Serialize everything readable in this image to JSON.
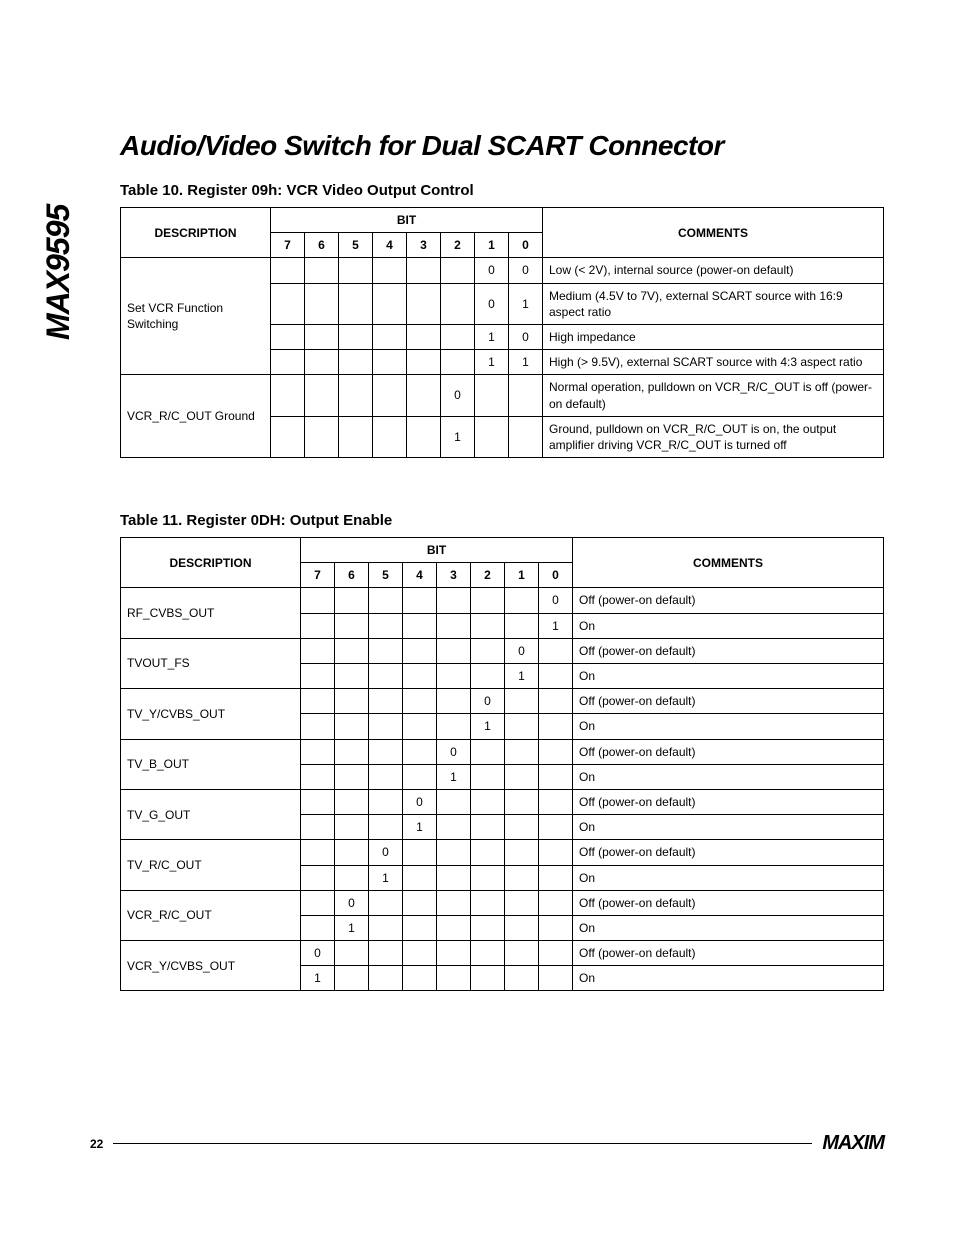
{
  "side_label": "MAX9595",
  "title": "Audio/Video Switch for Dual SCART Connector",
  "table10": {
    "caption": "Table 10. Register 09h: VCR Video Output Control",
    "headers": {
      "desc": "DESCRIPTION",
      "bit": "BIT",
      "bits": [
        "7",
        "6",
        "5",
        "4",
        "3",
        "2",
        "1",
        "0"
      ],
      "comments": "COMMENTS"
    },
    "groups": [
      {
        "desc": "Set VCR Function Switching",
        "rows": [
          {
            "b7": "",
            "b6": "",
            "b5": "",
            "b4": "",
            "b3": "",
            "b2": "",
            "b1": "0",
            "b0": "0",
            "comment": "Low (< 2V), internal source (power-on default)"
          },
          {
            "b7": "",
            "b6": "",
            "b5": "",
            "b4": "",
            "b3": "",
            "b2": "",
            "b1": "0",
            "b0": "1",
            "comment": "Medium (4.5V to 7V), external SCART source with 16:9 aspect ratio"
          },
          {
            "b7": "",
            "b6": "",
            "b5": "",
            "b4": "",
            "b3": "",
            "b2": "",
            "b1": "1",
            "b0": "0",
            "comment": "High impedance"
          },
          {
            "b7": "",
            "b6": "",
            "b5": "",
            "b4": "",
            "b3": "",
            "b2": "",
            "b1": "1",
            "b0": "1",
            "comment": "High (> 9.5V), external SCART source with 4:3 aspect ratio"
          }
        ]
      },
      {
        "desc": "VCR_R/C_OUT Ground",
        "rows": [
          {
            "b7": "",
            "b6": "",
            "b5": "",
            "b4": "",
            "b3": "",
            "b2": "0",
            "b1": "",
            "b0": "",
            "comment": "Normal operation, pulldown on VCR_R/C_OUT is off (power-on default)"
          },
          {
            "b7": "",
            "b6": "",
            "b5": "",
            "b4": "",
            "b3": "",
            "b2": "1",
            "b1": "",
            "b0": "",
            "comment": "Ground, pulldown on VCR_R/C_OUT is on, the output amplifier driving VCR_R/C_OUT is turned off"
          }
        ]
      }
    ]
  },
  "table11": {
    "caption": "Table 11. Register 0DH: Output Enable",
    "headers": {
      "desc": "DESCRIPTION",
      "bit": "BIT",
      "bits": [
        "7",
        "6",
        "5",
        "4",
        "3",
        "2",
        "1",
        "0"
      ],
      "comments": "COMMENTS"
    },
    "groups": [
      {
        "desc": "RF_CVBS_OUT",
        "rows": [
          {
            "b7": "",
            "b6": "",
            "b5": "",
            "b4": "",
            "b3": "",
            "b2": "",
            "b1": "",
            "b0": "0",
            "comment": "Off (power-on default)"
          },
          {
            "b7": "",
            "b6": "",
            "b5": "",
            "b4": "",
            "b3": "",
            "b2": "",
            "b1": "",
            "b0": "1",
            "comment": "On"
          }
        ]
      },
      {
        "desc": "TVOUT_FS",
        "rows": [
          {
            "b7": "",
            "b6": "",
            "b5": "",
            "b4": "",
            "b3": "",
            "b2": "",
            "b1": "0",
            "b0": "",
            "comment": "Off (power-on default)"
          },
          {
            "b7": "",
            "b6": "",
            "b5": "",
            "b4": "",
            "b3": "",
            "b2": "",
            "b1": "1",
            "b0": "",
            "comment": "On"
          }
        ]
      },
      {
        "desc": "TV_Y/CVBS_OUT",
        "rows": [
          {
            "b7": "",
            "b6": "",
            "b5": "",
            "b4": "",
            "b3": "",
            "b2": "0",
            "b1": "",
            "b0": "",
            "comment": "Off (power-on default)"
          },
          {
            "b7": "",
            "b6": "",
            "b5": "",
            "b4": "",
            "b3": "",
            "b2": "1",
            "b1": "",
            "b0": "",
            "comment": "On"
          }
        ]
      },
      {
        "desc": "TV_B_OUT",
        "rows": [
          {
            "b7": "",
            "b6": "",
            "b5": "",
            "b4": "",
            "b3": "0",
            "b2": "",
            "b1": "",
            "b0": "",
            "comment": "Off (power-on default)"
          },
          {
            "b7": "",
            "b6": "",
            "b5": "",
            "b4": "",
            "b3": "1",
            "b2": "",
            "b1": "",
            "b0": "",
            "comment": "On"
          }
        ]
      },
      {
        "desc": "TV_G_OUT",
        "rows": [
          {
            "b7": "",
            "b6": "",
            "b5": "",
            "b4": "0",
            "b3": "",
            "b2": "",
            "b1": "",
            "b0": "",
            "comment": "Off (power-on default)"
          },
          {
            "b7": "",
            "b6": "",
            "b5": "",
            "b4": "1",
            "b3": "",
            "b2": "",
            "b1": "",
            "b0": "",
            "comment": "On"
          }
        ]
      },
      {
        "desc": "TV_R/C_OUT",
        "rows": [
          {
            "b7": "",
            "b6": "",
            "b5": "0",
            "b4": "",
            "b3": "",
            "b2": "",
            "b1": "",
            "b0": "",
            "comment": "Off (power-on default)"
          },
          {
            "b7": "",
            "b6": "",
            "b5": "1",
            "b4": "",
            "b3": "",
            "b2": "",
            "b1": "",
            "b0": "",
            "comment": "On"
          }
        ]
      },
      {
        "desc": "VCR_R/C_OUT",
        "rows": [
          {
            "b7": "",
            "b6": "0",
            "b5": "",
            "b4": "",
            "b3": "",
            "b2": "",
            "b1": "",
            "b0": "",
            "comment": "Off (power-on default)"
          },
          {
            "b7": "",
            "b6": "1",
            "b5": "",
            "b4": "",
            "b3": "",
            "b2": "",
            "b1": "",
            "b0": "",
            "comment": "On"
          }
        ]
      },
      {
        "desc": "VCR_Y/CVBS_OUT",
        "rows": [
          {
            "b7": "0",
            "b6": "",
            "b5": "",
            "b4": "",
            "b3": "",
            "b2": "",
            "b1": "",
            "b0": "",
            "comment": "Off (power-on default)"
          },
          {
            "b7": "1",
            "b6": "",
            "b5": "",
            "b4": "",
            "b3": "",
            "b2": "",
            "b1": "",
            "b0": "",
            "comment": "On"
          }
        ]
      }
    ]
  },
  "footer": {
    "page": "22",
    "logo": "MAXIM"
  }
}
